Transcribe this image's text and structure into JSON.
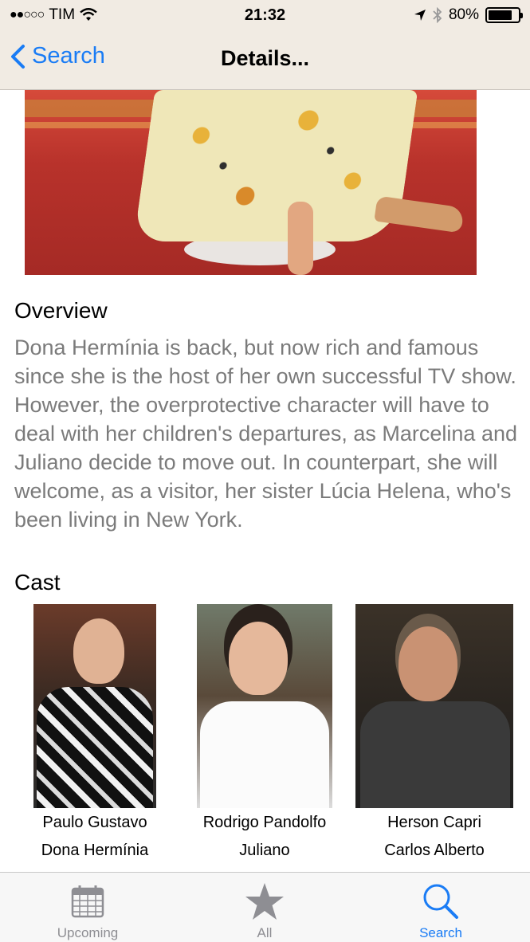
{
  "status_bar": {
    "signal": "●●○○○",
    "carrier": "TIM",
    "time": "21:32",
    "battery_percent": "80%",
    "battery_level": 0.8
  },
  "nav": {
    "back_label": "Search",
    "title": "Details..."
  },
  "overview": {
    "heading": "Overview",
    "text": "Dona Hermínia is back, but now rich and famous since she is the host of her own successful TV show. However, the overprotective character will have to deal with her children's departures, as Marcelina and Juliano decide to move out. In counterpart, she will welcome, as a visitor, her sister Lúcia Helena, who's been living in New York."
  },
  "cast": {
    "heading": "Cast",
    "members": [
      {
        "actor": "Paulo Gustavo",
        "character": "Dona Hermínia"
      },
      {
        "actor": "Rodrigo Pandolfo",
        "character": "Juliano"
      },
      {
        "actor": "Herson Capri",
        "character": "Carlos Alberto"
      }
    ]
  },
  "tabbar": {
    "tabs": [
      {
        "label": "Upcoming",
        "icon": "calendar-icon",
        "active": false
      },
      {
        "label": "All",
        "icon": "star-icon",
        "active": false
      },
      {
        "label": "Search",
        "icon": "search-icon",
        "active": true
      }
    ]
  },
  "colors": {
    "accent": "#1a7cf5",
    "inactive_tab": "#8e8e93",
    "overview_text": "#7b7b7b"
  }
}
